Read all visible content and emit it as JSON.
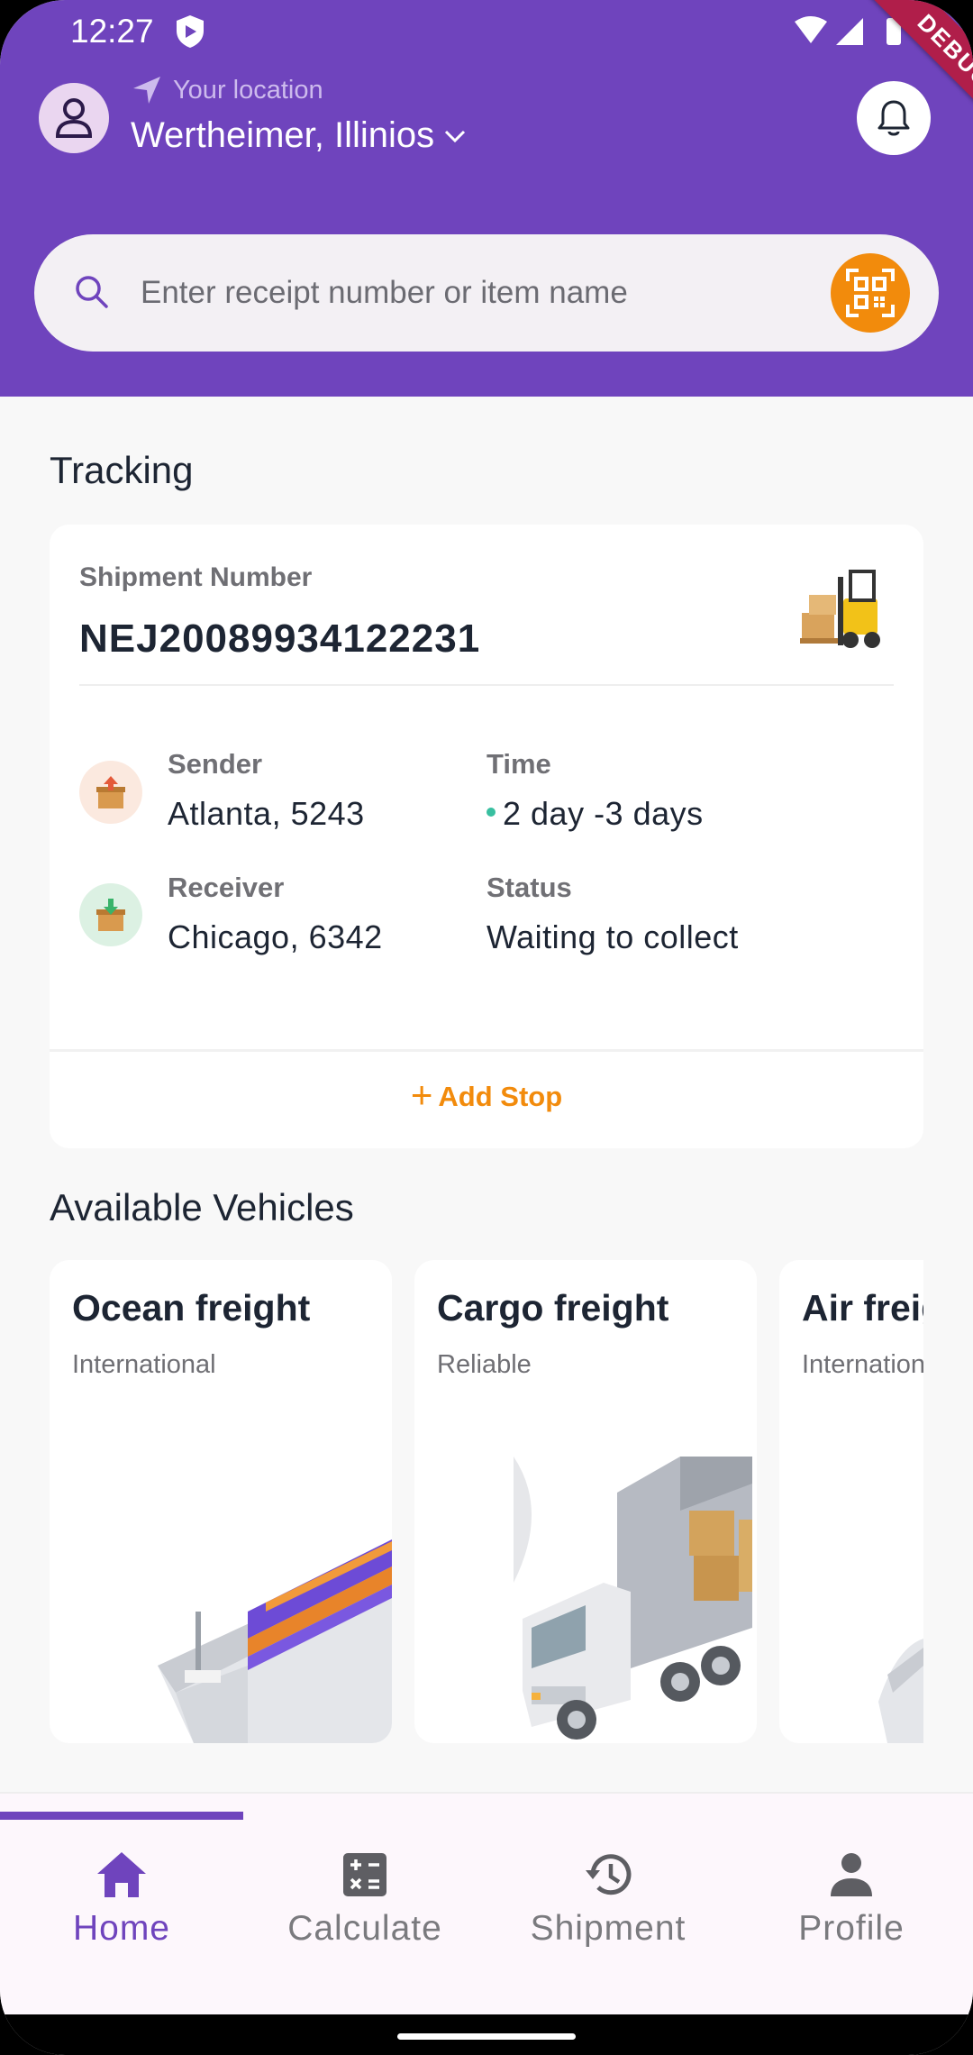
{
  "status_bar": {
    "time": "12:27",
    "debug_label": "DEBUG"
  },
  "header": {
    "location_label": "Your location",
    "location_value": "Wertheimer, Illinios",
    "background": "#6f44bd"
  },
  "search": {
    "placeholder": "Enter receipt number or item name"
  },
  "tracking": {
    "section_title": "Tracking",
    "shipment_number_label": "Shipment Number",
    "shipment_number": "NEJ20089934122231",
    "sender_label": "Sender",
    "sender_value": "Atlanta, 5243",
    "time_label": "Time",
    "time_value": "2 day -3 days",
    "receiver_label": "Receiver",
    "receiver_value": "Chicago, 6342",
    "status_label": "Status",
    "status_value": "Waiting to collect",
    "add_stop_label": "Add Stop",
    "accent": "#f28b0c"
  },
  "vehicles": {
    "section_title": "Available Vehicles",
    "items": [
      {
        "title": "Ocean freight",
        "subtitle": "International"
      },
      {
        "title": "Cargo freight",
        "subtitle": "Reliable"
      },
      {
        "title": "Air freight",
        "subtitle": "International"
      }
    ]
  },
  "nav": {
    "items": [
      {
        "label": "Home",
        "icon": "home-icon",
        "active": true
      },
      {
        "label": "Calculate",
        "icon": "calculator-icon",
        "active": false
      },
      {
        "label": "Shipment",
        "icon": "history-icon",
        "active": false
      },
      {
        "label": "Profile",
        "icon": "person-icon",
        "active": false
      }
    ]
  }
}
